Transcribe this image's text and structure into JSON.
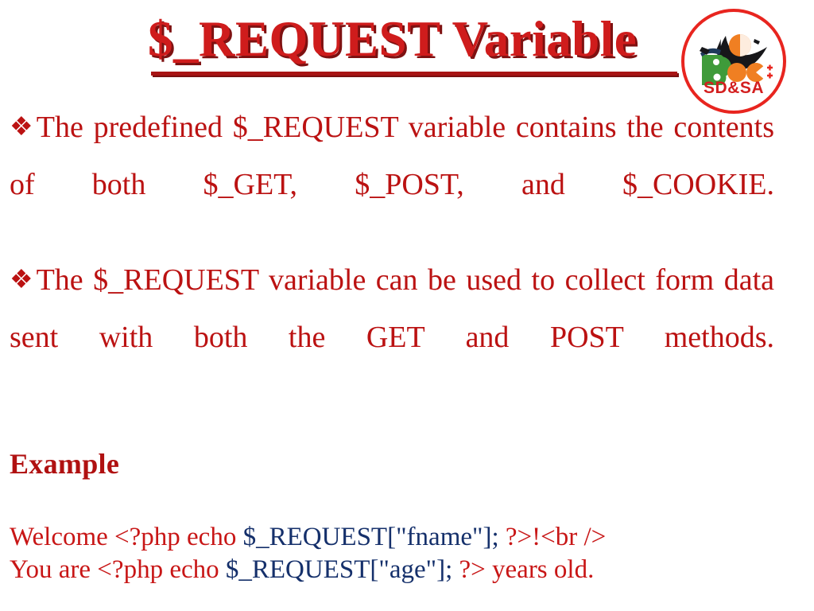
{
  "slide": {
    "title": "$_REQUEST Variable",
    "background_color": "#ffffff",
    "title_color": "#cf1c1c",
    "title_shadow_color": "#7e1111",
    "body_color": "#bb1212",
    "code_red_color": "#c81616",
    "code_blue_color": "#15306b"
  },
  "logo": {
    "name": "bvoc-sdsa-logo",
    "ring_color": "#e8251f",
    "letter_b_color": "#3f9b3a",
    "accent_orange": "#f07f22",
    "accent_black": "#1a1a1a",
    "wordmark": "B.Voc",
    "subtext": "SD&SA",
    "subtext_color": "#d31f1f"
  },
  "bullets": [
    {
      "glyph": "❖",
      "text": "The predefined $_REQUEST variable contains the contents of both $_GET, $_POST, and $_COOKIE."
    },
    {
      "glyph": "❖",
      "text": "The $_REQUEST variable can be used to collect form data sent with both the GET and POST methods."
    }
  ],
  "example": {
    "heading": "Example",
    "code_lines": [
      {
        "prefix": "Welcome <?php echo ",
        "variable": "$_REQUEST[\"fname\"];",
        "suffix": " ?>!<br />"
      },
      {
        "prefix": "You are <?php echo ",
        "variable": "$_REQUEST[\"age\"];",
        "suffix": " ?> years old."
      }
    ]
  }
}
